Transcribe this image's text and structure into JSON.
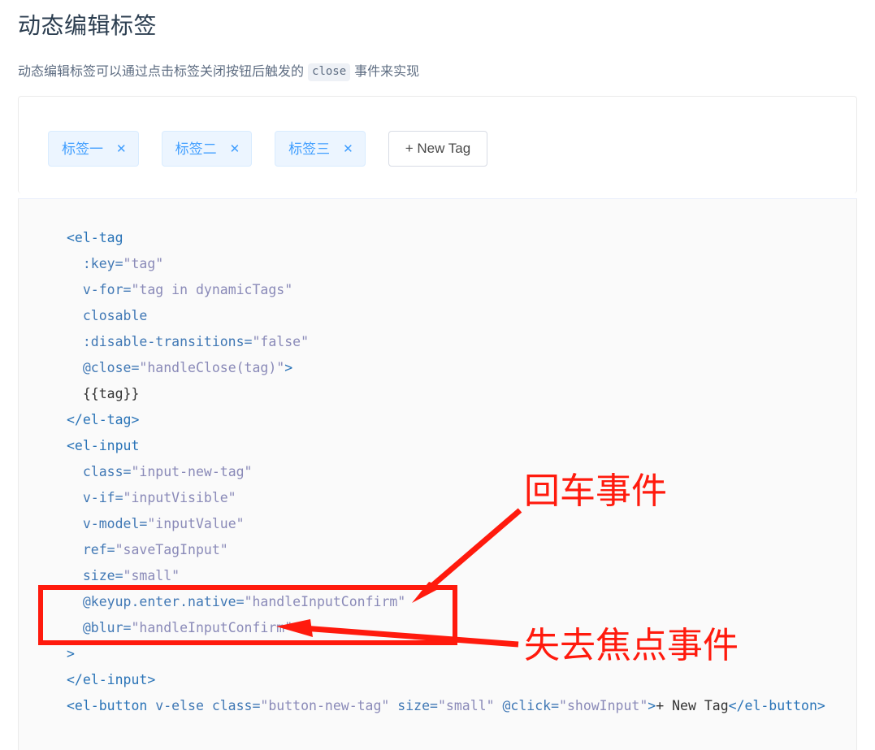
{
  "page": {
    "title": "动态编辑标签",
    "description_before": "动态编辑标签可以通过点击标签关闭按钮后触发的",
    "description_code": "close",
    "description_after": "事件来实现"
  },
  "demo": {
    "tags": [
      {
        "label": "标签一",
        "close_icon": "close-icon"
      },
      {
        "label": "标签二",
        "close_icon": "close-icon"
      },
      {
        "label": "标签三",
        "close_icon": "close-icon"
      }
    ],
    "close_glyph": "✕",
    "new_tag_button": "+ New Tag"
  },
  "code": {
    "lines": [
      {
        "indent": 0,
        "parts": [
          {
            "t": "tag",
            "s": "<el-tag"
          }
        ]
      },
      {
        "indent": 1,
        "parts": [
          {
            "t": "attr",
            "s": ":key="
          },
          {
            "t": "val",
            "s": "\"tag\""
          }
        ]
      },
      {
        "indent": 1,
        "parts": [
          {
            "t": "attr",
            "s": "v-for="
          },
          {
            "t": "val",
            "s": "\"tag in dynamicTags\""
          }
        ]
      },
      {
        "indent": 1,
        "parts": [
          {
            "t": "attr",
            "s": "closable"
          }
        ]
      },
      {
        "indent": 1,
        "parts": [
          {
            "t": "attr",
            "s": ":disable-transitions="
          },
          {
            "t": "val",
            "s": "\"false\""
          }
        ]
      },
      {
        "indent": 1,
        "parts": [
          {
            "t": "attr",
            "s": "@close="
          },
          {
            "t": "val",
            "s": "\"handleClose(tag)\""
          },
          {
            "t": "tag",
            "s": ">"
          }
        ]
      },
      {
        "indent": 1,
        "parts": [
          {
            "t": "plain",
            "s": "{{tag}}"
          }
        ]
      },
      {
        "indent": 0,
        "parts": [
          {
            "t": "tag",
            "s": "</el-tag>"
          }
        ]
      },
      {
        "indent": 0,
        "parts": [
          {
            "t": "tag",
            "s": "<el-input"
          }
        ]
      },
      {
        "indent": 1,
        "parts": [
          {
            "t": "attr",
            "s": "class="
          },
          {
            "t": "val",
            "s": "\"input-new-tag\""
          }
        ]
      },
      {
        "indent": 1,
        "parts": [
          {
            "t": "attr",
            "s": "v-if="
          },
          {
            "t": "val",
            "s": "\"inputVisible\""
          }
        ]
      },
      {
        "indent": 1,
        "parts": [
          {
            "t": "attr",
            "s": "v-model="
          },
          {
            "t": "val",
            "s": "\"inputValue\""
          }
        ]
      },
      {
        "indent": 1,
        "parts": [
          {
            "t": "attr",
            "s": "ref="
          },
          {
            "t": "val",
            "s": "\"saveTagInput\""
          }
        ]
      },
      {
        "indent": 1,
        "parts": [
          {
            "t": "attr",
            "s": "size="
          },
          {
            "t": "val",
            "s": "\"small\""
          }
        ]
      },
      {
        "indent": 1,
        "parts": [
          {
            "t": "attr",
            "s": "@keyup.enter.native="
          },
          {
            "t": "val",
            "s": "\"handleInputConfirm\""
          }
        ]
      },
      {
        "indent": 1,
        "parts": [
          {
            "t": "attr",
            "s": "@blur="
          },
          {
            "t": "val",
            "s": "\"handleInputConfirm\""
          }
        ]
      },
      {
        "indent": 0,
        "parts": [
          {
            "t": "tag",
            "s": ">"
          }
        ]
      },
      {
        "indent": 0,
        "parts": [
          {
            "t": "tag",
            "s": "</el-input>"
          }
        ]
      },
      {
        "indent": 0,
        "parts": [
          {
            "t": "tag",
            "s": "<el-button "
          },
          {
            "t": "attr",
            "s": "v-else class="
          },
          {
            "t": "val",
            "s": "\"button-new-tag\""
          },
          {
            "t": "attr",
            "s": " size="
          },
          {
            "t": "val",
            "s": "\"small\""
          },
          {
            "t": "attr",
            "s": " @click="
          },
          {
            "t": "val",
            "s": "\"showInput\""
          },
          {
            "t": "tag",
            "s": ">"
          },
          {
            "t": "plain",
            "s": "+ New Tag"
          },
          {
            "t": "tag",
            "s": "</el-button>"
          }
        ]
      }
    ]
  },
  "annotations": {
    "enter_event": "回车事件",
    "blur_event": "失去焦点事件",
    "highlight_color": "#ff1a0d"
  }
}
